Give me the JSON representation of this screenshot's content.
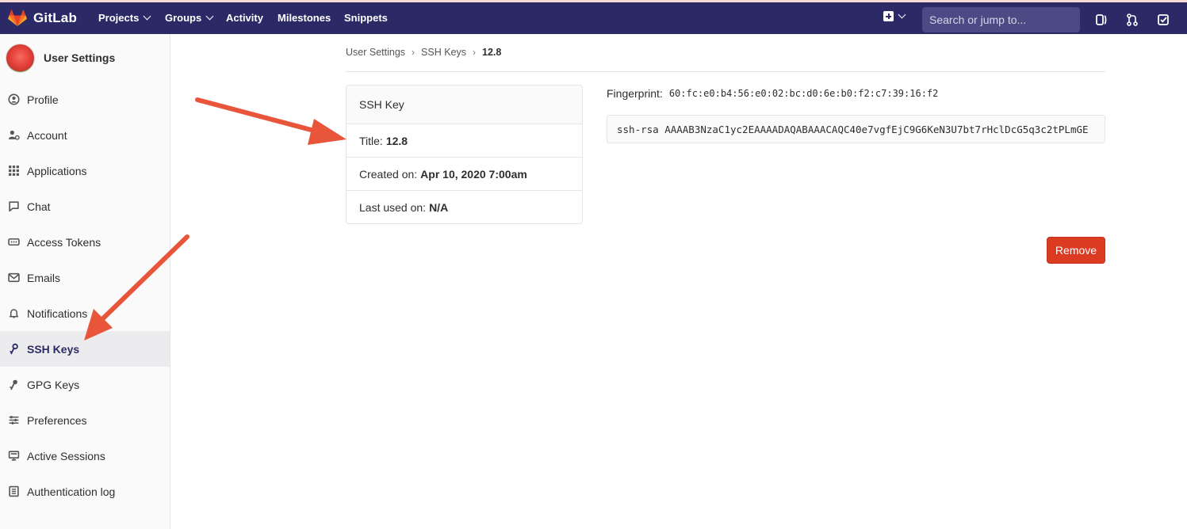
{
  "brand": {
    "name": "GitLab"
  },
  "nav": {
    "items": [
      {
        "label": "Projects",
        "dropdown": true
      },
      {
        "label": "Groups",
        "dropdown": true
      },
      {
        "label": "Activity",
        "dropdown": false
      },
      {
        "label": "Milestones",
        "dropdown": false
      },
      {
        "label": "Snippets",
        "dropdown": false
      }
    ],
    "search_placeholder": "Search or jump to..."
  },
  "sidebar": {
    "title": "User Settings",
    "items": [
      {
        "label": "Profile",
        "icon": "profile-icon"
      },
      {
        "label": "Account",
        "icon": "account-icon"
      },
      {
        "label": "Applications",
        "icon": "applications-icon"
      },
      {
        "label": "Chat",
        "icon": "chat-icon"
      },
      {
        "label": "Access Tokens",
        "icon": "access-tokens-icon"
      },
      {
        "label": "Emails",
        "icon": "emails-icon"
      },
      {
        "label": "Notifications",
        "icon": "notifications-icon"
      },
      {
        "label": "SSH Keys",
        "icon": "key-icon",
        "active": true
      },
      {
        "label": "GPG Keys",
        "icon": "key-icon"
      },
      {
        "label": "Preferences",
        "icon": "preferences-icon"
      },
      {
        "label": "Active Sessions",
        "icon": "monitor-icon"
      },
      {
        "label": "Authentication log",
        "icon": "log-icon"
      }
    ]
  },
  "breadcrumb": [
    "User Settings",
    "SSH Keys",
    "12.8"
  ],
  "key_card": {
    "header": "SSH Key",
    "title_label": "Title:",
    "title_value": "12.8",
    "created_label": "Created on:",
    "created_value": "Apr 10, 2020 7:00am",
    "last_used_label": "Last used on:",
    "last_used_value": "N/A"
  },
  "fingerprint": {
    "label": "Fingerprint:",
    "value": "60:fc:e0:b4:56:e0:02:bc:d0:6e:b0:f2:c7:39:16:f2"
  },
  "public_key": "ssh-rsa AAAAB3NzaC1yc2EAAAADAQABAAACAQC40e7vgfEjC9G6KeN3U7bt7rHclDcG5q3c2tPLmGE",
  "remove_button": "Remove",
  "colors": {
    "nav_bg": "#2b2a66",
    "danger": "#db3b21",
    "arrow": "#e8553a"
  }
}
